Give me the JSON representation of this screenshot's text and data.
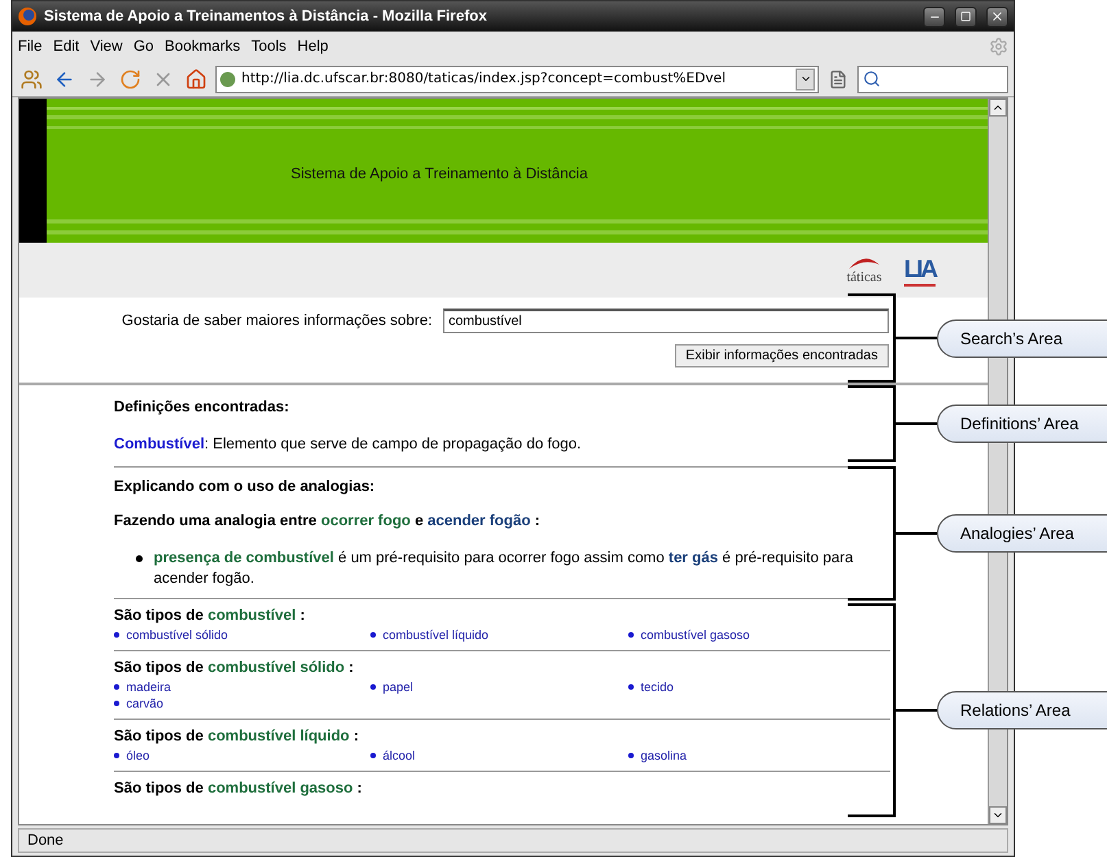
{
  "window": {
    "title": "Sistema de Apoio a Treinamentos à Distância - Mozilla Firefox"
  },
  "menu": [
    "File",
    "Edit",
    "View",
    "Go",
    "Bookmarks",
    "Tools",
    "Help"
  ],
  "address_bar": {
    "value": "http://lia.dc.ufscar.br:8080/taticas/index.jsp?concept=combust%EDvel"
  },
  "banner": {
    "title": "Sistema de Apoio a Treinamento à Distância",
    "logos": [
      "táticas",
      "LIA"
    ]
  },
  "search": {
    "label": "Gostaria de saber maiores informações sobre:",
    "value": "combustível",
    "button": "Exibir informações encontradas"
  },
  "definitions": {
    "heading": "Definições encontradas:",
    "term": "Combustível",
    "text": ": Elemento que serve de campo de propagação do fogo."
  },
  "analogies": {
    "heading": "Explicando com o uso de analogias:",
    "intro": [
      {
        "kind": "plain",
        "text": "Fazendo uma analogia entre"
      },
      {
        "kind": "source",
        "text": "ocorrer fogo"
      },
      {
        "kind": "plain",
        "text": "e"
      },
      {
        "kind": "target",
        "text": "acender fogão"
      },
      {
        "kind": "plain",
        "text": ":"
      }
    ],
    "items": [
      [
        {
          "kind": "source",
          "text": "presença de combustível"
        },
        {
          "kind": "plain",
          "text": "é um pré-requisito para ocorrer fogo assim como"
        },
        {
          "kind": "target",
          "text": "ter gás"
        },
        {
          "kind": "plain",
          "text": "é pré-requisito para acender fogão."
        }
      ]
    ]
  },
  "relations": [
    {
      "prefix": "São tipos de",
      "concept": "combustível",
      "suffix": ":",
      "items": [
        "combustível sólido",
        "combustível líquido",
        "combustível gasoso"
      ]
    },
    {
      "prefix": "São tipos de",
      "concept": "combustível sólido",
      "suffix": ":",
      "items": [
        "madeira",
        "papel",
        "tecido",
        "carvão"
      ]
    },
    {
      "prefix": "São tipos de",
      "concept": "combustível líquido",
      "suffix": ":",
      "items": [
        "óleo",
        "álcool",
        "gasolina"
      ]
    },
    {
      "prefix": "São tipos de",
      "concept": "combustível gasoso",
      "suffix": ":"
    }
  ],
  "status_bar": "Done",
  "annotations": [
    "Search’s Area",
    "Definitions’ Area",
    "Analogies’ Area",
    "Relations’ Area"
  ]
}
